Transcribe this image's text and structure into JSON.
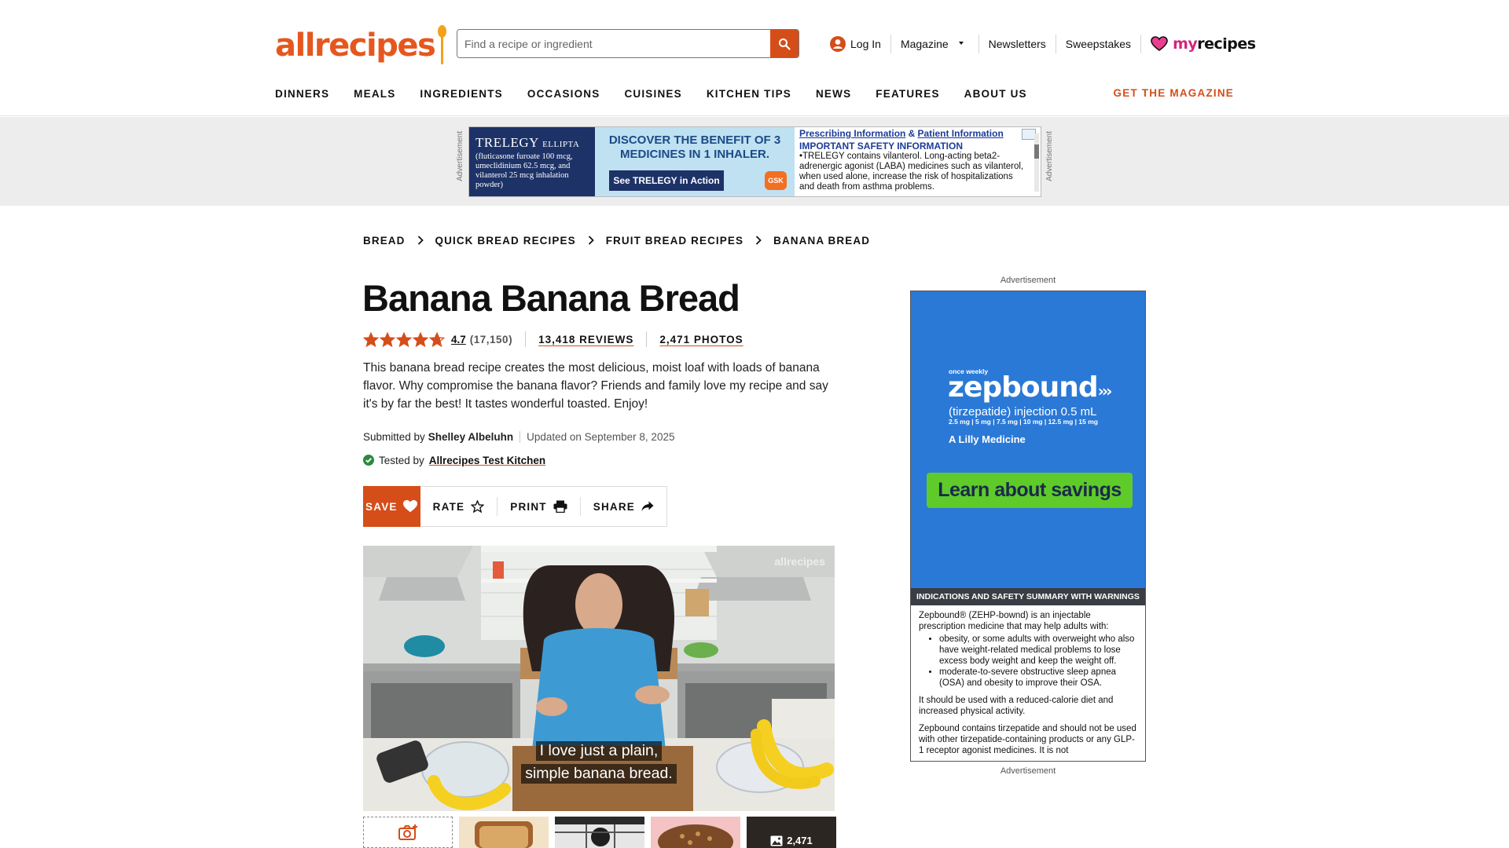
{
  "header": {
    "logo_text": "allrecipes",
    "search_placeholder": "Find a recipe or ingredient",
    "login": "Log In",
    "magazine": "Magazine",
    "newsletters": "Newsletters",
    "sweepstakes": "Sweepstakes",
    "myrecipes_my": "my",
    "myrecipes_rest": "recipes",
    "brand_color": "#e5571e",
    "accent_color": "#d54d19"
  },
  "nav": {
    "items": [
      "DINNERS",
      "MEALS",
      "INGREDIENTS",
      "OCCASIONS",
      "CUISINES",
      "KITCHEN TIPS",
      "NEWS",
      "FEATURES",
      "ABOUT US"
    ],
    "get_magazine": "GET THE MAGAZINE"
  },
  "top_ad": {
    "label": "Advertisement",
    "brand": "TRELEGY",
    "brand_sub": "ELLIPTA",
    "fine": "(fluticasone furoate 100 mcg, umeclidinium 62.5 mcg, and vilanterol 25 mcg inhalation powder)",
    "headline": "DISCOVER THE BENEFIT OF 3 MEDICINES IN 1 INHALER.",
    "cta": "See TRELEGY in Action",
    "gsk": "GSK",
    "prescribing": "Prescribing Information",
    "amp": "&",
    "patient": "Patient Information",
    "isi_title": "IMPORTANT SAFETY INFORMATION",
    "isi_text": "•TRELEGY contains vilanterol. Long-acting beta2-adrenergic agonist (LABA) medicines such as vilanterol, when used alone, increase the risk of hospitalizations and death from asthma problems."
  },
  "breadcrumb": [
    "BREAD",
    "QUICK BREAD RECIPES",
    "FRUIT BREAD RECIPES",
    "BANANA BREAD"
  ],
  "recipe": {
    "title": "Banana Banana Bread",
    "rating": "4.7",
    "rating_value": 4.7,
    "rating_count": "(17,150)",
    "reviews": "13,418 REVIEWS",
    "photos": "2,471 PHOTOS",
    "description": "This banana bread recipe creates the most delicious, moist loaf with loads of banana flavor. Why compromise the banana flavor? Friends and family love my recipe and say it's by far the best! It tastes wonderful toasted. Enjoy!",
    "submitted_by_label": "Submitted by",
    "author": "Shelley Albeluhn",
    "updated": "Updated on September 8, 2025",
    "tested_by_label": "Tested by",
    "tester": "Allrecipes Test Kitchen"
  },
  "actions": {
    "save": "SAVE",
    "rate": "RATE",
    "print": "PRINT",
    "share": "SHARE"
  },
  "video": {
    "caption_line1": "I love just a plain,",
    "caption_line2": "simple banana bread.",
    "watermark": "allrecipes"
  },
  "thumbs": {
    "more_count": "2,471"
  },
  "side_ad": {
    "label_top": "Advertisement",
    "label_bottom": "Advertisement",
    "once_weekly": "once weekly",
    "brand": "zepbound",
    "injection": "(tirzepatide) injection 0.5 mL",
    "doses": "2.5 mg | 5 mg | 7.5 mg | 10 mg | 12.5 mg | 15 mg",
    "company": "A Lilly Medicine",
    "cta": "Learn about savings",
    "isi_title": "INDICATIONS AND SAFETY SUMMARY WITH WARNINGS",
    "para1": "Zepbound® (ZEHP-bownd) is an injectable prescription medicine that may help adults with:",
    "bullet1": "obesity, or some adults with overweight who also have weight-related medical problems to lose excess body weight and keep the weight off.",
    "bullet2": "moderate-to-severe obstructive sleep apnea (OSA) and obesity to improve their OSA.",
    "para2": "It should be used with a reduced-calorie diet and increased physical activity.",
    "para3": "Zepbound contains tirzepatide and should not be used with other tirzepatide-containing products or any GLP-1 receptor agonist medicines. It is not"
  }
}
